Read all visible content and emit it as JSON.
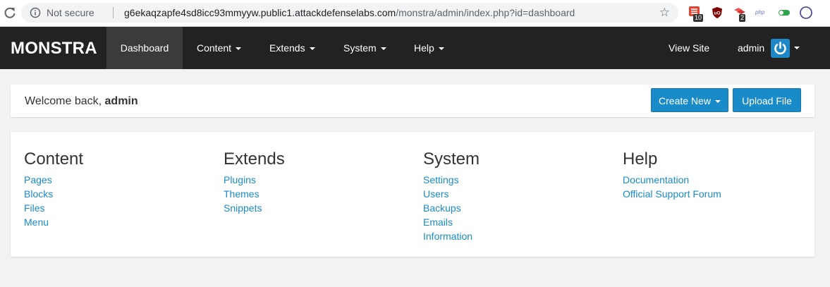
{
  "browser": {
    "security_label": "Not secure",
    "url_host": "g6ekaqzapfe4sd8icc93mmyyw.public1.attackdefenselabs.com",
    "url_path": "/monstra/admin/index.php?id=dashboard",
    "extensions": [
      {
        "icon": "todoist-icon",
        "badge": "10"
      },
      {
        "icon": "ublock-icon",
        "badge": ""
      },
      {
        "icon": "wappalyzer-icon",
        "badge": "2"
      },
      {
        "icon": "php-icon",
        "badge": ""
      },
      {
        "icon": "toggle-icon",
        "badge": ""
      },
      {
        "icon": "profile-icon",
        "badge": ""
      }
    ]
  },
  "navbar": {
    "brand": "MONSTRA",
    "items": [
      {
        "label": "Dashboard",
        "active": true
      },
      {
        "label": "Content"
      },
      {
        "label": "Extends"
      },
      {
        "label": "System"
      },
      {
        "label": "Help"
      }
    ],
    "view_site": "View Site",
    "user": "admin"
  },
  "welcome": {
    "prefix": "Welcome back, ",
    "username": "admin",
    "create_new": "Create New",
    "upload_file": "Upload File"
  },
  "sections": [
    {
      "title": "Content",
      "links": [
        "Pages",
        "Blocks",
        "Files",
        "Menu"
      ]
    },
    {
      "title": "Extends",
      "links": [
        "Plugins",
        "Themes",
        "Snippets"
      ]
    },
    {
      "title": "System",
      "links": [
        "Settings",
        "Users",
        "Backups",
        "Emails",
        "Information"
      ]
    },
    {
      "title": "Help",
      "links": [
        "Documentation",
        "Official Support Forum"
      ]
    }
  ],
  "colors": {
    "navbar_bg": "#222222",
    "accent": "#1a8bc9",
    "page_bg": "#f2f2f2"
  }
}
